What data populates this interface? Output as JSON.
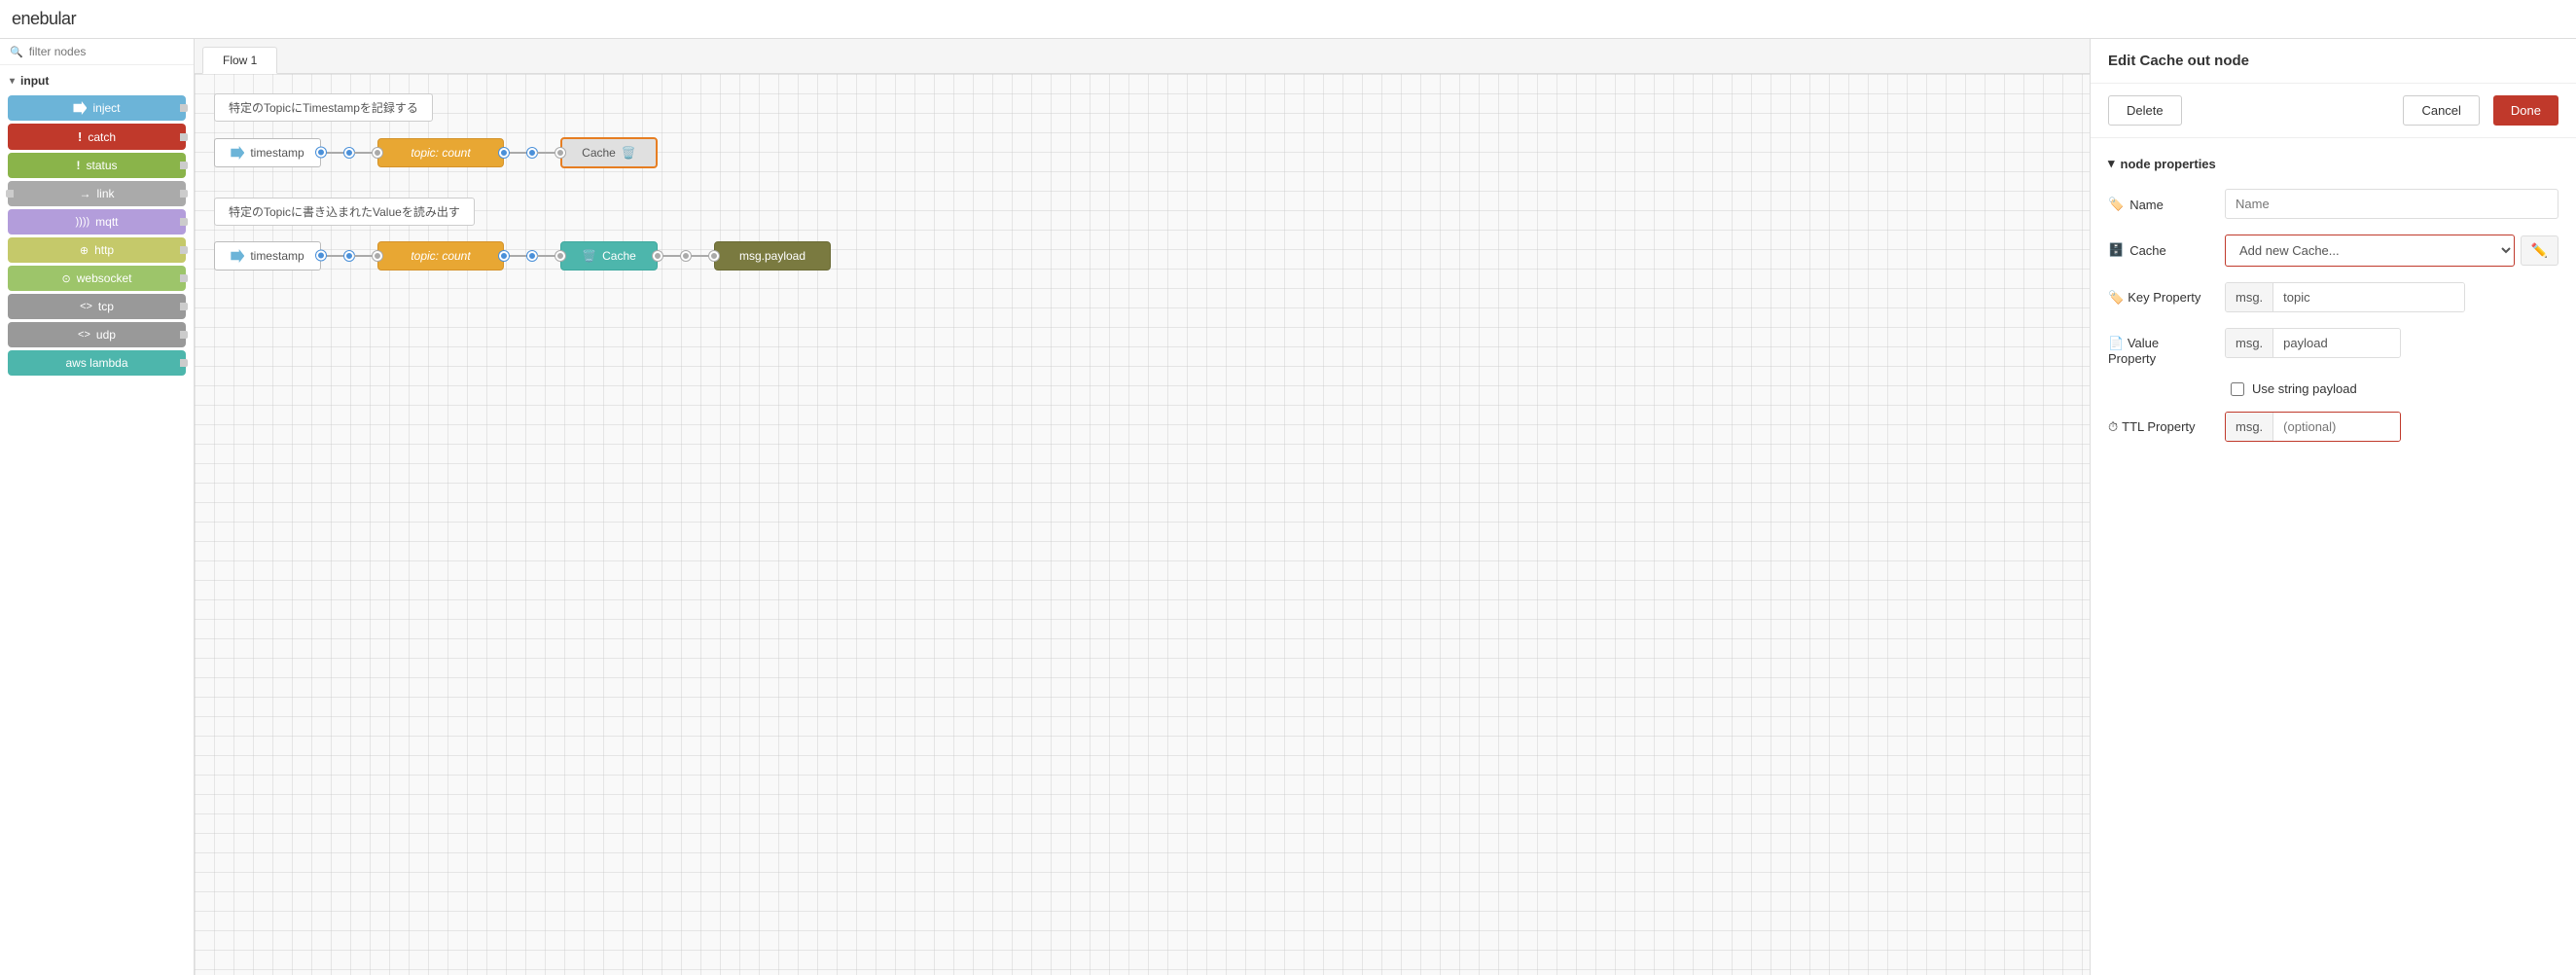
{
  "app": {
    "logo": "enebular"
  },
  "sidebar": {
    "filter_placeholder": "filter nodes",
    "section_label": "input",
    "nodes": [
      {
        "id": "inject",
        "label": "inject",
        "color": "#6cb4d8",
        "has_left": false,
        "has_right": true
      },
      {
        "id": "catch",
        "label": "catch",
        "color": "#c0392b",
        "has_left": false,
        "has_right": true
      },
      {
        "id": "status",
        "label": "status",
        "color": "#8ab44a",
        "has_left": false,
        "has_right": true
      },
      {
        "id": "link",
        "label": "link",
        "color": "#aaa",
        "has_left": true,
        "has_right": true
      },
      {
        "id": "mqtt",
        "label": "mqtt",
        "color": "#b39ddb",
        "has_left": false,
        "has_right": true
      },
      {
        "id": "http",
        "label": "http",
        "color": "#c5c96a",
        "has_left": false,
        "has_right": true
      },
      {
        "id": "websocket",
        "label": "websocket",
        "color": "#9dc56a",
        "has_left": false,
        "has_right": true
      },
      {
        "id": "tcp",
        "label": "tcp",
        "color": "#999",
        "has_left": false,
        "has_right": true
      },
      {
        "id": "udp",
        "label": "udp",
        "color": "#999",
        "has_left": false,
        "has_right": true
      },
      {
        "id": "aws-lambda",
        "label": "aws lambda",
        "color": "#4db6ac",
        "has_left": false,
        "has_right": true
      }
    ]
  },
  "canvas": {
    "tab_label": "Flow 1",
    "flow1": {
      "label": "特定のTopicにTimestampを記録する",
      "nodes": [
        {
          "type": "timestamp",
          "label": "timestamp"
        },
        {
          "type": "func",
          "label": "topic: count"
        },
        {
          "type": "cache-out",
          "label": "Cache"
        }
      ]
    },
    "flow2": {
      "label": "特定のTopicに書き込まれたValueを読み出す",
      "nodes": [
        {
          "type": "timestamp",
          "label": "timestamp"
        },
        {
          "type": "func",
          "label": "topic: count"
        },
        {
          "type": "cache-in",
          "label": "Cache"
        },
        {
          "type": "msg",
          "label": "msg.payload"
        }
      ]
    }
  },
  "right_panel": {
    "title": "Edit Cache out node",
    "btn_delete": "Delete",
    "btn_cancel": "Cancel",
    "btn_done": "Done",
    "section_label": "node properties",
    "props": {
      "name_label": "Name",
      "name_placeholder": "Name",
      "cache_label": "Cache",
      "cache_placeholder": "Add new Cache...",
      "key_label": "Key Property",
      "key_prefix": "msg.",
      "key_value": "topic",
      "value_label": "Value",
      "value_sublabel": "Property",
      "value_prefix": "msg.",
      "value_value": "payload",
      "checkbox_label": "Use string payload",
      "ttl_label": "TTL Property",
      "ttl_prefix": "msg.",
      "ttl_placeholder": "(optional)"
    }
  }
}
